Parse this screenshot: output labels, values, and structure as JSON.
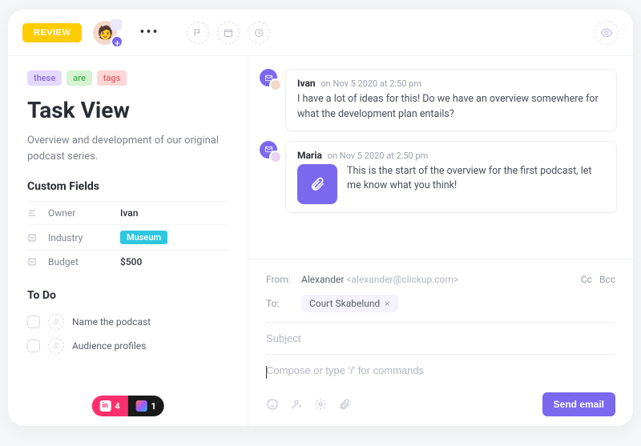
{
  "topbar": {
    "review_label": "REVIEW"
  },
  "tags": [
    "these",
    "are",
    "tags"
  ],
  "title": "Task View",
  "description": "Overview and development of our original podcast series.",
  "custom_fields": {
    "heading": "Custom Fields",
    "owner_label": "Owner",
    "owner_value": "Ivan",
    "industry_label": "Industry",
    "industry_value": "Museum",
    "budget_label": "Budget",
    "budget_value": "$500"
  },
  "todo": {
    "heading": "To Do",
    "items": [
      "Name the podcast",
      "Audience profiles"
    ]
  },
  "bottom_badges": {
    "invision_count": "4",
    "figma_count": "1"
  },
  "comments": [
    {
      "author": "Ivan",
      "timestamp": "on Nov 5 2020 at 2:50 pm",
      "body": "I have a lot of ideas for this! Do we have an overview somewhere for what the development plan entails?"
    },
    {
      "author": "Maria",
      "timestamp": "on Nov 5 2020 at 2:50 pm",
      "body": "This is the start of the overview for the first podcast, let me know what you think!"
    }
  ],
  "composer": {
    "from_label": "From:",
    "from_name": "Alexander",
    "from_email": "<alexander@clickup.com>",
    "cc_label": "Cc",
    "bcc_label": "Bcc",
    "to_label": "To:",
    "to_chip": "Court Skabelund",
    "subject_placeholder": "Subject",
    "body_placeholder": "Compose or type '/' for commands",
    "send_label": "Send email"
  }
}
